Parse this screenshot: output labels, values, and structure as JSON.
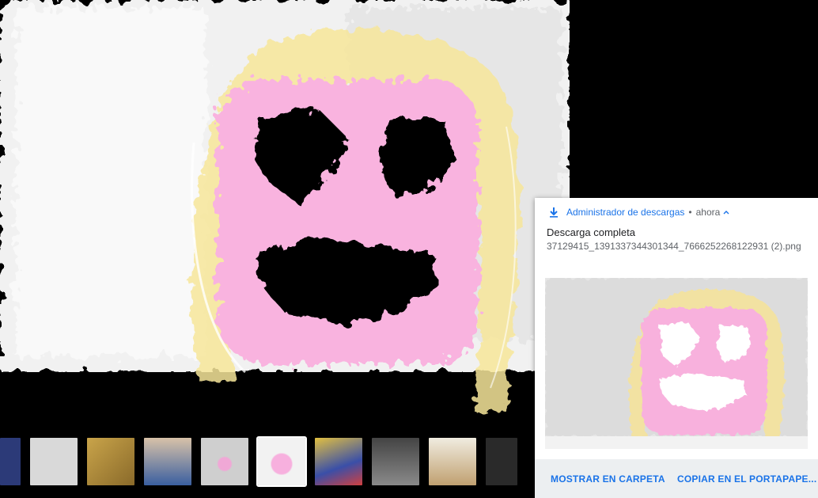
{
  "notification": {
    "app_name": "Administrador de descargas",
    "separator": "•",
    "time": "ahora",
    "title": "Descarga completa",
    "filename": "37129415_1391337344301344_7666252268122931 (2).png",
    "actions": {
      "show_in_folder": "MOSTRAR EN CARPETA",
      "copy_to_clipboard": "COPIAR EN EL PORTAPAPE..."
    },
    "accent_color": "#1a73e8"
  },
  "filmstrip": {
    "thumbnails": [
      {
        "name": "thumb-1",
        "color": "#2c3a78"
      },
      {
        "name": "thumb-2",
        "color": "#d9d9d9"
      },
      {
        "name": "thumb-3",
        "color": "#c9a44a"
      },
      {
        "name": "thumb-4",
        "color": "#b78c70"
      },
      {
        "name": "thumb-5",
        "color": "#cfcfcf"
      },
      {
        "name": "thumb-6-selected",
        "color": "#f2f2f2"
      },
      {
        "name": "thumb-7",
        "color": "#3a4fa8"
      },
      {
        "name": "thumb-8",
        "color": "#6a6a6a"
      },
      {
        "name": "thumb-9",
        "color": "#e8e4d8"
      },
      {
        "name": "thumb-10",
        "color": "#2a2a2a"
      }
    ]
  }
}
